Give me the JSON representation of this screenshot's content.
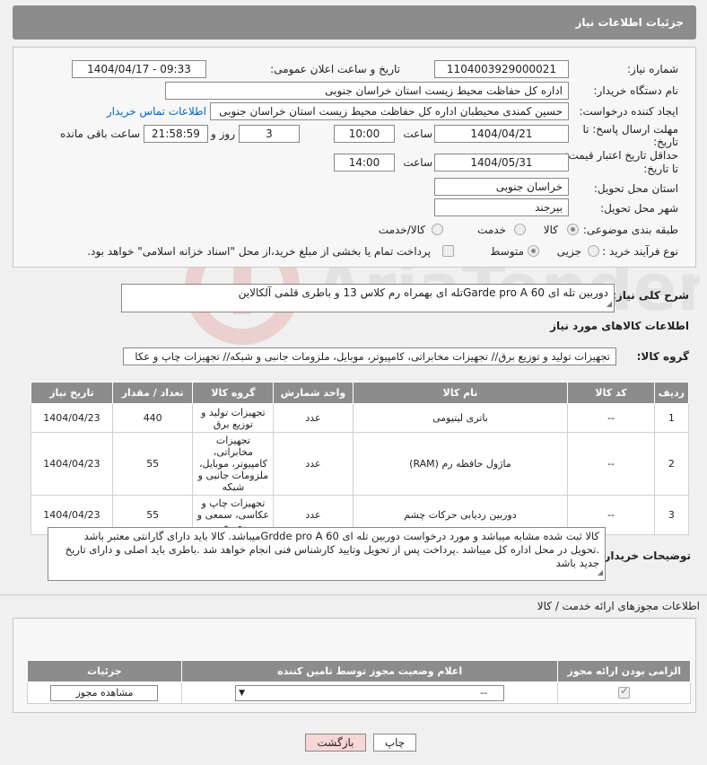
{
  "header": {
    "title": "جزئیات اطلاعات نیاز"
  },
  "form": {
    "need_number_label": "شماره نیاز:",
    "need_number": "1104003929000021",
    "announce_label": "تاریخ و ساعت اعلان عمومی:",
    "announce_value": "1404/04/17 - 09:33",
    "buyer_org_label": "نام دستگاه خریدار:",
    "buyer_org": "اداره کل حفاظت محیط زیست استان خراسان جنوبی",
    "creator_label": "ایجاد کننده درخواست:",
    "creator": "حسین کمندی محیطبان  اداره کل حفاظت محیط زیست استان خراسان جنوبی",
    "contact_link": "اطلاعات تماس خریدار",
    "deadline_label_1": "مهلت ارسال پاسخ: تا",
    "deadline_label_2": "تاریخ:",
    "deadline_date": "1404/04/21",
    "time_label": "ساعت",
    "deadline_time": "10:00",
    "days_value": "3",
    "days_label": "روز و",
    "remaining_time": "21:58:59",
    "remaining_label": "ساعت باقی مانده",
    "validity_label_1": "حداقل تاریخ اعتبار قیمت:",
    "validity_label_2": "تا تاریخ:",
    "validity_date": "1404/05/31",
    "validity_time": "14:00",
    "province_label": "استان محل تحویل:",
    "province": "خراسان جنوبی",
    "city_label": "شهر محل تحویل:",
    "city": "بیرجند",
    "category_label": "طبقه بندی موضوعی:",
    "category_options": [
      "کالا",
      "خدمت",
      "کالا/خدمت"
    ],
    "process_label": "نوع فرآیند خرید :",
    "process_options": [
      "جزیی",
      "متوسط"
    ],
    "process_note": "پرداخت تمام یا بخشی از مبلغ خرید،از محل \"اسناد خزانه اسلامی\" خواهد بود.",
    "summary_label": "شرح کلی نیاز:",
    "summary": "دوربین تله ای  Garde pro A 60تله ای  بهمراه رم کلاس 13 و باطری قلمی آلکالاین"
  },
  "goods_section": {
    "title": "اطلاعات کالاهای مورد نیاز",
    "group_label": "گروه کالا:",
    "group_value": "تجهیزات تولید و توزیع برق// تجهیزات مخابراتی، کامپیوتر، موبایل، ملزومات جانبی و شبکه// تجهیزات چاپ و عکا"
  },
  "goods_table": {
    "headers": [
      "ردیف",
      "کد کالا",
      "نام کالا",
      "واحد شمارش",
      "گروه کالا",
      "تعداد / مقدار",
      "تاریخ نیاز"
    ],
    "rows": [
      [
        "1",
        "--",
        "باتری لیتیومی",
        "عدد",
        "تجهیزات تولید و توزیع برق",
        "440",
        "1404/04/23"
      ],
      [
        "2",
        "--",
        "ماژول حافظه رم (RAM)",
        "عدد",
        "تجهیزات مخابراتی، کامپیوتر، موبایل، ملزومات جانبی و شبکه",
        "55",
        "1404/04/23"
      ],
      [
        "3",
        "--",
        "دوربین ردیابی حرکات چشم",
        "عدد",
        "تجهیزات چاپ و عکاسی، سمعی و بصری",
        "55",
        "1404/04/23"
      ]
    ]
  },
  "buyer_notes": {
    "label": "توضیحات خریدار:",
    "text": "کالا ثبت شده مشابه میباشد و مورد درخواست دوربین تله ای Grdde pro A 60میباشد.  کالا باید دارای گارانتی معتبر باشد .تحویل در محل اداره کل میباشد .پرداخت پس از تحویل وتایید کارشناس فنی انجام خواهد شد .باطری باید اصلی و دارای تاریخ جدید باشد"
  },
  "permits": {
    "title": "اطلاعات مجوزهای ارائه خدمت / کالا",
    "headers": [
      "الزامی بودن ارائه مجوز",
      "اعلام وضعیت مجوز توسط تامین کننده",
      "جزئیات"
    ],
    "select_value": "--",
    "view_button": "مشاهده مجوز"
  },
  "footer": {
    "print_button": "چاپ",
    "back_button": "بازگشت"
  },
  "colors": {
    "header_bg": "#8c8c8c",
    "link": "#0066cc",
    "back_button_bg": "#f9d6d6"
  }
}
